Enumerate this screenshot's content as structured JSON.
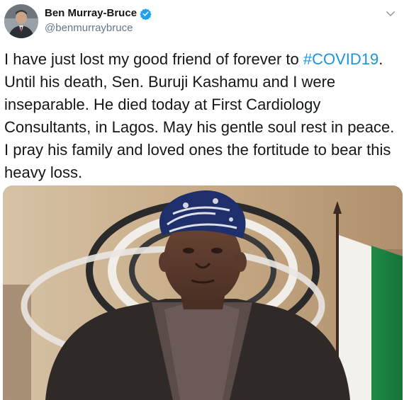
{
  "user": {
    "display_name": "Ben Murray-Bruce",
    "handle": "@benmurraybruce",
    "verified": true
  },
  "tweet": {
    "text_parts": {
      "p1": "I have just lost my good friend of forever to ",
      "hashtag": "#COVID19",
      "p2": ". Until his death, Sen. Buruji Kashamu and I were inseparable. He died today at First Cardiology Consultants, in Lagos. May his gentle soul rest in peace. I pray his family and loved ones the fortitude to bear this heavy loss."
    }
  },
  "icons": {
    "verified": "verified-badge-icon",
    "menu": "chevron-down-icon"
  },
  "colors": {
    "hashtag": "#1b95e0",
    "handle": "#657786",
    "verified": "#1da1f2"
  }
}
